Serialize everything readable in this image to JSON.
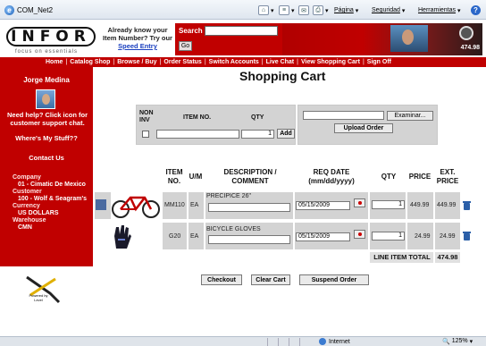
{
  "browser": {
    "tab_title": "COM_Net2",
    "commands": [
      "Página",
      "Seguridad",
      "Herramientas"
    ],
    "status_zone": "Internet",
    "zoom": "125%"
  },
  "header": {
    "logo_text": "INFOR",
    "logo_tagline": "focus on essentials",
    "know_line1": "Already know your",
    "know_line2": "Item Number? Try our",
    "speed_entry": "Speed Entry",
    "search_label": "Search",
    "go_label": "Go",
    "banner_number": "474.98"
  },
  "nav": [
    "Home",
    "Catalog Shop",
    "Browse / Buy",
    "Order Status",
    "Switch Accounts",
    "Live Chat",
    "View Shopping Cart",
    "Sign Off"
  ],
  "sidebar": {
    "user_name": "Jorge Medina",
    "help_line1": "Need help? Click icon for",
    "help_line2": "customer support chat.",
    "wheres_my_stuff": "Where's My Stuff??",
    "contact_us": "Contact Us",
    "company_label": "Company",
    "company_value": "01 - Cimatic De Mexico",
    "customer_label": "Customer",
    "customer_value": "100 - Wolf & Seagram's",
    "currency_label": "Currency",
    "currency_value": "US DOLLARS",
    "warehouse_label": "Warehouse",
    "warehouse_value": "CMN"
  },
  "powered_by": "Powered by Level",
  "page_title": "Shopping Cart",
  "entry": {
    "non_inv_label": "NON INV",
    "item_no_label": "ITEM NO.",
    "qty_label": "QTY",
    "qty_value": "1",
    "add_label": "Add",
    "browse_label": "Examinar...",
    "upload_label": "Upload Order"
  },
  "cart": {
    "headers": {
      "item_no": "ITEM NO.",
      "um": "U/M",
      "desc": "DESCRIPTION / COMMENT",
      "req_date": "REQ DATE (mm/dd/yyyy)",
      "qty": "QTY",
      "price": "PRICE",
      "ext_price": "EXT. PRICE"
    },
    "rows": [
      {
        "item": "MM110",
        "um": "EA",
        "desc": "PRECIPICE 26\"",
        "date": "05/15/2009",
        "qty": "1",
        "price": "449.99",
        "ext": "449.99"
      },
      {
        "item": "G20",
        "um": "EA",
        "desc": "BICYCLE GLOVES",
        "date": "05/15/2009",
        "qty": "1",
        "price": "24.99",
        "ext": "24.99"
      }
    ],
    "total_label": "LINE ITEM TOTAL",
    "total_value": "474.98"
  },
  "actions": {
    "checkout": "Checkout",
    "clear_cart": "Clear Cart",
    "suspend_order": "Suspend Order"
  }
}
